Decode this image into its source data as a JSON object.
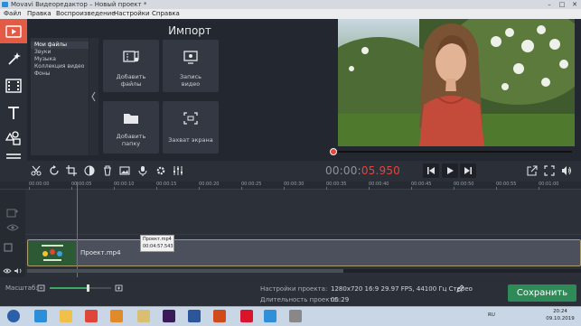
{
  "window": {
    "title": "Movavi Видеоредактор – Новый проект *",
    "controls": [
      "minimize-icon",
      "maximize-icon",
      "close-icon"
    ]
  },
  "menu": {
    "items": [
      "Файл",
      "Правка",
      "Воспроизведение",
      "Настройки",
      "Справка"
    ]
  },
  "tools": [
    {
      "name": "import-tool",
      "icon": "film-import-icon",
      "active": true
    },
    {
      "name": "filters-tool",
      "icon": "magic-wand-icon",
      "active": false
    },
    {
      "name": "transitions-tool",
      "icon": "film-transition-icon",
      "active": false
    },
    {
      "name": "titles-tool",
      "icon": "text-t-icon",
      "active": false
    },
    {
      "name": "stickers-tool",
      "icon": "shapes-icon",
      "active": false
    },
    {
      "name": "more-tool",
      "icon": "menu-lines-icon",
      "active": false
    }
  ],
  "import": {
    "title": "Импорт",
    "sidebar": [
      "Мои файлы",
      "Звуки",
      "Музыка",
      "Коллекция видео",
      "Фоны"
    ],
    "tiles": [
      {
        "line1": "Добавить",
        "line2": "файлы",
        "icon": "add-files-icon"
      },
      {
        "line1": "Запись",
        "line2": "видео",
        "icon": "webcam-icon"
      },
      {
        "line1": "Добавить",
        "line2": "папку",
        "icon": "folder-icon"
      },
      {
        "line1": "Захват экрана",
        "line2": "",
        "icon": "screen-capture-icon"
      }
    ]
  },
  "player": {
    "timecode_dim": "00:00:",
    "timecode_hi": "05.950",
    "progress": 0.0
  },
  "ruler": {
    "ticks": [
      "00:00:00",
      "00:00:05",
      "00:00:10",
      "00:00:15",
      "00:00:20",
      "00:00:25",
      "00:00:30",
      "00:00:35",
      "00:00:40",
      "00:00:45",
      "00:00:50",
      "00:00:55",
      "00:01:00"
    ]
  },
  "clip": {
    "label": "Проект.mp4",
    "tooltip_name": "Проект.mp4",
    "tooltip_time": "00:04:57.543"
  },
  "status": {
    "zoom_label": "Масштаб:",
    "zoom_level": 0.62,
    "settings_label": "Настройки проекта:",
    "settings_value": "1280x720 16:9 29.97 FPS, 44100 Гц Стерео",
    "duration_label": "Длительность проекта:",
    "duration_value": "05:29",
    "save_button": "Сохранить"
  },
  "taskbar": {
    "lang": "RU",
    "time": "20:24",
    "date": "09.10.2019",
    "apps": [
      {
        "name": "start-button",
        "color": "#2b5fa8"
      },
      {
        "name": "ie-app",
        "color": "#2a8fd8"
      },
      {
        "name": "explorer-app",
        "color": "#f0c04a"
      },
      {
        "name": "chrome-app",
        "color": "#e0453a"
      },
      {
        "name": "media-app",
        "color": "#e08a2a"
      },
      {
        "name": "files-app",
        "color": "#d8c070"
      },
      {
        "name": "premiere-app",
        "color": "#3b1a5a"
      },
      {
        "name": "word-app",
        "color": "#2b579a"
      },
      {
        "name": "app-orange",
        "color": "#d04a1a"
      },
      {
        "name": "opera-app",
        "color": "#d8152a"
      },
      {
        "name": "movavi-app",
        "color": "#2f8fd8"
      },
      {
        "name": "screen-app",
        "color": "#888888"
      }
    ]
  },
  "colors": {
    "accent": "#e35b45",
    "timecode": "#e6453a",
    "save": "#2e8b57"
  }
}
